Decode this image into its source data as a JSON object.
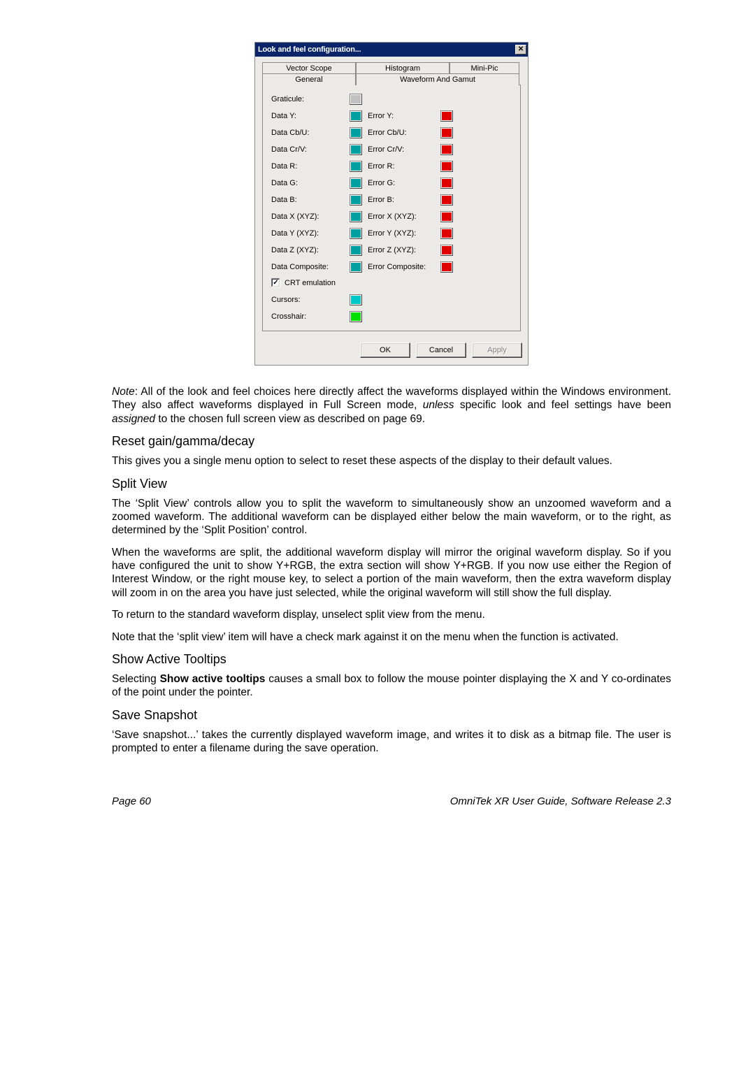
{
  "dialog": {
    "title": "Look and feel configuration...",
    "tabs": {
      "vector_scope": "Vector Scope",
      "histogram": "Histogram",
      "mini_pic": "Mini-Pic",
      "general": "General",
      "waveform_gamut": "Waveform And Gamut"
    },
    "fields": {
      "graticule": "Graticule:",
      "data_y": "Data Y:",
      "error_y": "Error Y:",
      "data_cbu": "Data Cb/U:",
      "error_cbu": "Error Cb/U:",
      "data_crv": "Data Cr/V:",
      "error_crv": "Error Cr/V:",
      "data_r": "Data R:",
      "error_r": "Error R:",
      "data_g": "Data G:",
      "error_g": "Error G:",
      "data_b": "Data B:",
      "error_b": "Error B:",
      "data_x_xyz": "Data X (XYZ):",
      "error_x_xyz": "Error X (XYZ):",
      "data_y_xyz": "Data Y (XYZ):",
      "error_y_xyz": "Error Y (XYZ):",
      "data_z_xyz": "Data Z (XYZ):",
      "error_z_xyz": "Error Z (XYZ):",
      "data_composite": "Data Composite:",
      "error_composite": "Error Composite:",
      "crt_emulation": "CRT emulation",
      "cursors": "Cursors:",
      "crosshair": "Crosshair:"
    },
    "buttons": {
      "ok": "OK",
      "cancel": "Cancel",
      "apply": "Apply"
    },
    "close_glyph": "✕"
  },
  "doc": {
    "note_label": "Note",
    "note_text": ": All of the look and feel choices here directly affect the waveforms displayed within the Windows environment. They also affect waveforms displayed in Full Screen mode, ",
    "unless": "unless",
    "note_text2": " specific look and feel settings have been ",
    "assigned": "assigned",
    "note_text3": " to the chosen full screen view as described on page 69.",
    "h_reset": "Reset gain/gamma/decay",
    "p_reset": "This gives you a single menu option to select to reset these aspects of the display to their default values.",
    "h_split": "Split View",
    "p_split1": "The ‘Split View’ controls allow you to split the waveform to simultaneously show an unzoomed waveform and a zoomed waveform. The additional waveform can be displayed either below the main waveform, or to the right, as determined by the ‘Split Position’ control.",
    "p_split2": "When the waveforms are split, the additional waveform display will mirror the original waveform display. So if you have configured the unit to show Y+RGB, the extra section will show Y+RGB. If you now use either the Region of Interest Window, or the right mouse key, to select a portion of the main waveform, then the extra waveform display will zoom in on the area you have just selected, while the original waveform will still show the full display.",
    "p_split3": "To return to the standard waveform display, unselect split view from the menu.",
    "p_split4": "Note that the ‘split view’ item will have a check mark against it on the menu when the function is activated.",
    "h_tooltips": "Show Active Tooltips",
    "p_tooltips_a": "Selecting ",
    "p_tooltips_b": "Show active tooltips",
    "p_tooltips_c": " causes a small box to follow the mouse pointer displaying the X and Y co-ordinates of the point under the pointer.",
    "h_snapshot": "Save Snapshot",
    "p_snapshot": "‘Save snapshot...’ takes the currently displayed waveform image, and writes it to disk as a bitmap file. The user is prompted to enter a filename during the save operation."
  },
  "footer": {
    "left": "Page 60",
    "right": "OmniTek XR User Guide, Software Release 2.3"
  }
}
